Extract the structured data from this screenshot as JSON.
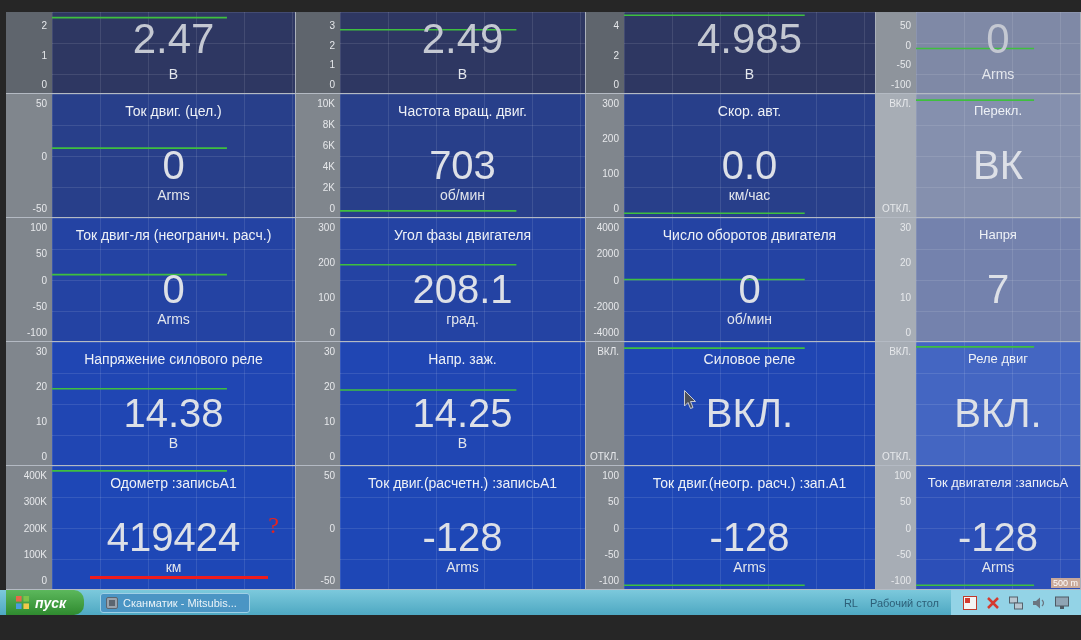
{
  "rows": [
    {
      "panels": [
        {
          "ticks": [
            "2",
            "1",
            "0"
          ],
          "value": "2.47",
          "unit": "В"
        },
        {
          "ticks": [
            "3",
            "2",
            "1",
            "0"
          ],
          "value": "2.49",
          "unit": "В"
        },
        {
          "ticks": [
            "4",
            "2",
            "0"
          ],
          "value": "4.985",
          "unit": "В"
        },
        {
          "ticks": [
            "50",
            "0",
            "-50",
            "-100"
          ],
          "value": "0",
          "unit": "Arms"
        }
      ]
    },
    {
      "panels": [
        {
          "ticks": [
            "50",
            "0",
            "-50"
          ],
          "title": "Ток двиг. (цел.)",
          "value": "0",
          "unit": "Arms"
        },
        {
          "ticks": [
            "10K",
            "8K",
            "6K",
            "4K",
            "2K",
            "0"
          ],
          "title": "Частота вращ. двиг.",
          "value": "703",
          "unit": "об/мин"
        },
        {
          "ticks": [
            "300",
            "200",
            "100",
            "0"
          ],
          "title": "Скор. авт.",
          "value": "0.0",
          "unit": "км/час"
        },
        {
          "ticks": [
            "ВКЛ.",
            "ОТКЛ."
          ],
          "title": "Перекл.",
          "value": "ВК"
        }
      ]
    },
    {
      "panels": [
        {
          "ticks": [
            "100",
            "50",
            "0",
            "-50",
            "-100"
          ],
          "title": "Ток двиг-ля (неогранич. расч.)",
          "value": "0",
          "unit": "Arms"
        },
        {
          "ticks": [
            "300",
            "200",
            "100",
            "0"
          ],
          "title": "Угол фазы двигателя",
          "value": "208.1",
          "unit": "град."
        },
        {
          "ticks": [
            "4000",
            "2000",
            "0",
            "-2000",
            "-4000"
          ],
          "title": "Число оборотов двигателя",
          "value": "0",
          "unit": "об/мин"
        },
        {
          "ticks": [
            "30",
            "20",
            "10",
            "0"
          ],
          "title": "Напря",
          "value": "7"
        }
      ]
    },
    {
      "panels": [
        {
          "ticks": [
            "30",
            "20",
            "10",
            "0"
          ],
          "title": "Напряжение силового реле",
          "value": "14.38",
          "unit": "В"
        },
        {
          "ticks": [
            "30",
            "20",
            "10",
            "0"
          ],
          "title": "Напр. заж.",
          "value": "14.25",
          "unit": "В"
        },
        {
          "ticks": [
            "ВКЛ.",
            "ОТКЛ."
          ],
          "title": "Силовое реле",
          "value": "ВКЛ.",
          "pointer": true
        },
        {
          "ticks": [
            "ВКЛ.",
            "ОТКЛ."
          ],
          "title": "Реле двиг",
          "value": "ВКЛ."
        }
      ]
    },
    {
      "panels": [
        {
          "ticks": [
            "400K",
            "300K",
            "200K",
            "100K",
            "0"
          ],
          "title": "Одометр :записьА1",
          "value": "419424",
          "unit": "км",
          "annotation": {
            "text": "?",
            "underline": true
          }
        },
        {
          "ticks": [
            "50",
            "0",
            "-50"
          ],
          "title": "Ток двиг.(расчетн.) :записьА1",
          "value": "-128",
          "unit": "Arms"
        },
        {
          "ticks": [
            "100",
            "50",
            "0",
            "-50",
            "-100"
          ],
          "title": "Ток двиг.(неогр. расч.) :зап.А1",
          "value": "-128",
          "unit": "Arms"
        },
        {
          "ticks": [
            "100",
            "50",
            "0",
            "-50",
            "-100"
          ],
          "title": "Ток двигателя :записьА",
          "value": "-128",
          "unit": "Arms",
          "scale_label": "500 m"
        }
      ]
    }
  ],
  "taskbar": {
    "start_button": "пуск",
    "tasks": [
      {
        "label": "Сканматик - Mitsubis...",
        "selected": false
      }
    ],
    "toolbar_label": "RL",
    "desktop_label": "Рабочий стол"
  }
}
